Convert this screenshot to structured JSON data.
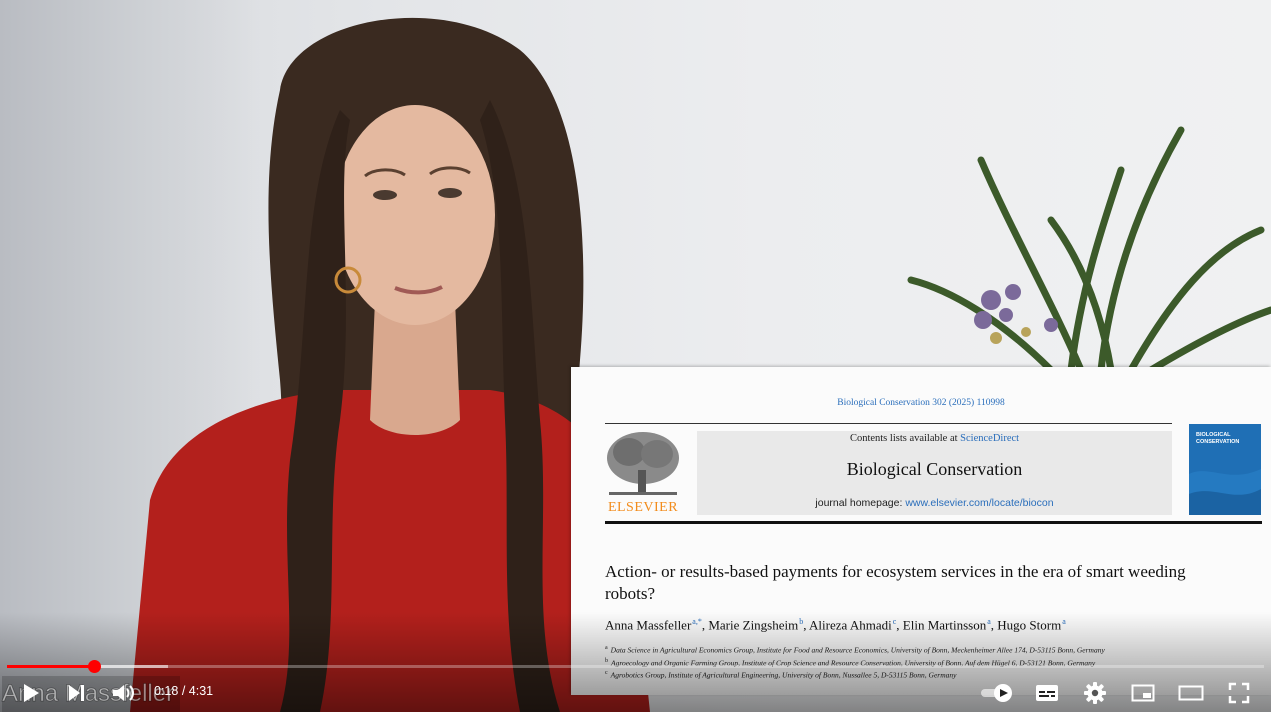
{
  "video": {
    "name_overlay": "Anna Massfeller",
    "current_time": "0:18",
    "time_separator": " / ",
    "duration": "4:31",
    "progress_fraction": 0.069,
    "buffered_fraction": 0.128
  },
  "paper": {
    "citation": "Biological Conservation 302 (2025) 110998",
    "contents_prefix": "Contents lists available at ",
    "contents_link": "ScienceDirect",
    "journal_name": "Biological Conservation",
    "homepage_prefix": "journal homepage: ",
    "homepage_link": "www.elsevier.com/locate/biocon",
    "publisher": "ELSEVIER",
    "cover_title": "BIOLOGICAL CONSERVATION",
    "title": "Action- or results-based payments for ecosystem services in the era of smart weeding robots?",
    "authors": [
      {
        "name": "Anna Massfeller",
        "sup": "a,*"
      },
      {
        "name": "Marie Zingsheim",
        "sup": "b"
      },
      {
        "name": "Alireza Ahmadi",
        "sup": "c"
      },
      {
        "name": "Elin Martinsson",
        "sup": "a"
      },
      {
        "name": "Hugo Storm",
        "sup": "a"
      }
    ],
    "author_separator": ", ",
    "affiliations": [
      {
        "sup": "a",
        "text": "Data Science in Agricultural Economics Group, Institute for Food and Resource Economics, University of Bonn, Meckenheimer Allee 174, D-53115 Bonn, Germany"
      },
      {
        "sup": "b",
        "text": "Agroecology and Organic Farming Group, Institute of Crop Science and Resource Conservation, University of Bonn, Auf dem Hügel 6, D-53121 Bonn, Germany"
      },
      {
        "sup": "c",
        "text": "Agrobotics Group, Institute of Agricultural Engineering, University of Bonn, Nussallee 5, D-53115 Bonn, Germany"
      }
    ]
  },
  "controls": {
    "left": [
      {
        "name": "play-button",
        "icon": "play-icon"
      },
      {
        "name": "next-button",
        "icon": "next-icon"
      },
      {
        "name": "volume-button",
        "icon": "volume-icon"
      }
    ],
    "right": [
      {
        "name": "autoplay-toggle",
        "icon": "autoplay-toggle-icon"
      },
      {
        "name": "subtitles-button",
        "icon": "subtitles-icon"
      },
      {
        "name": "settings-button",
        "icon": "gear-icon"
      },
      {
        "name": "miniplayer-button",
        "icon": "miniplayer-icon"
      },
      {
        "name": "theater-mode-button",
        "icon": "theater-icon"
      },
      {
        "name": "fullscreen-button",
        "icon": "fullscreen-icon"
      }
    ]
  },
  "colors": {
    "progress_played": "#ff0000",
    "link": "#2a6ebb",
    "publisher_orange": "#f28c1c",
    "cover_blue": "#1f6fb5",
    "sweater_red": "#b3201c"
  }
}
